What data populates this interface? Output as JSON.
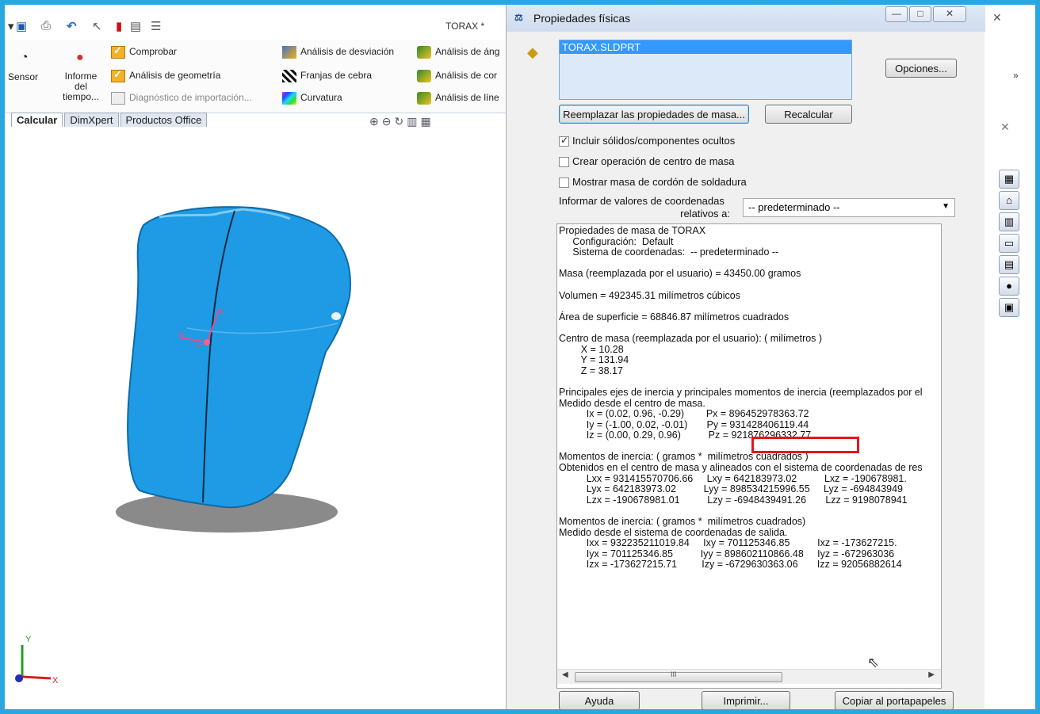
{
  "toolbar": {
    "doc_title": "TORAX *"
  },
  "ribbon": {
    "sensor": "Sensor",
    "informe": [
      "Informe",
      "del",
      "tiempo..."
    ],
    "comprobar": "Comprobar",
    "analisis_geometria": "Análisis de geometría",
    "diagnostico": "Diagnóstico de importación...",
    "analisis_desviacion": "Análisis de desviación",
    "franjas": "Franjas de cebra",
    "curvatura": "Curvatura",
    "analisis_ang": "Análisis de áng",
    "analisis_con": "Análisis de cor",
    "analisis_lin": "Análisis de líne"
  },
  "tabs": [
    "Calcular",
    "DimXpert",
    "Productos Office"
  ],
  "viewport": {
    "axis_y": "Y",
    "axis_x": "X",
    "tri_ix": "Ix",
    "tri_iy": "Iy",
    "tri_iz": "Iz"
  },
  "dialog": {
    "title": "Propiedades físicas",
    "file": "TORAX.SLDPRT",
    "opciones": "Opciones...",
    "reemplazar": "Reemplazar las propiedades de masa...",
    "recalcular": "Recalcular",
    "chk_ocultos": "Incluir sólidos/componentes ocultos",
    "chk_centro": "Crear operación de centro de masa",
    "chk_soldadura": "Mostrar masa de cordón de soldadura",
    "coord_label_1": "Informar de valores de coordenadas",
    "coord_label_2": "relativos a:",
    "coord_value": "-- predeterminado --",
    "results_text": "Propiedades de masa de TORAX\n     Configuración:  Default\n     Sistema de coordenadas:  -- predeterminado --\n\nMasa (reemplazada por el usuario) = 43450.00 gramos\n\nVolumen = 492345.31 milímetros cúbicos\n\nÁrea de superficie = 68846.87 milímetros cuadrados\n\nCentro de masa (reemplazada por el usuario): ( milímetros )\n        X = 10.28\n        Y = 131.94\n        Z = 38.17\n\nPrincipales ejes de inercia y principales momentos de inercia (reemplazados por el\nMedido desde el centro de masa.\n          Ix = (0.02, 0.96, -0.29)        Px = 896452978363.72\n          Iy = (-1.00, 0.02, -0.01)       Py = 931428406119.44\n          Iz = (0.00, 0.29, 0.96)          Pz = 921876296332.77\n\nMomentos de inercia: ( gramos *  milímetros cuadrados )\nObtenidos en el centro de masa y alineados con el sistema de coordenadas de res\n          Lxx = 931415570706.66     Lxy = 642183973.02          Lxz = -190678981.\n          Lyx = 642183973.02          Lyy = 898534215996.55     Lyz = -694843949\n          Lzx = -190678981.01          Lzy = -6948439491.26       Lzz = 9198078941\n\nMomentos de inercia: ( gramos *  milímetros cuadrados)\nMedido desde el sistema de coordenadas de salida.\n          Ixx = 932235211019.84     Ixy = 701125346.85          Ixz = -173627215.\n          Iyx = 701125346.85          Iyy = 898602110866.48     Iyz = -672963036\n          Izx = -173627215.71         Izy = -6729630363.06       Izz = 92056882614",
    "scroll_mark": "III",
    "ayuda": "Ayuda",
    "imprimir": "Imprimir...",
    "copiar": "Copiar al portapapeles",
    "checks": {
      "ocultos": true,
      "centro": false,
      "soldadura": false
    }
  },
  "colors": {
    "frame": "#29a8e0",
    "model": "#1e9be4",
    "highlight": "#e8141c"
  },
  "icons": [
    "save-icon",
    "print-icon",
    "undo-icon",
    "select-icon",
    "rebuild-icon",
    "options-icon",
    "sensor-icon",
    "report-icon",
    "zoom-icon",
    "part-icon",
    "minimize-icon",
    "maximize-icon",
    "close-icon",
    "task-pane-icon"
  ]
}
